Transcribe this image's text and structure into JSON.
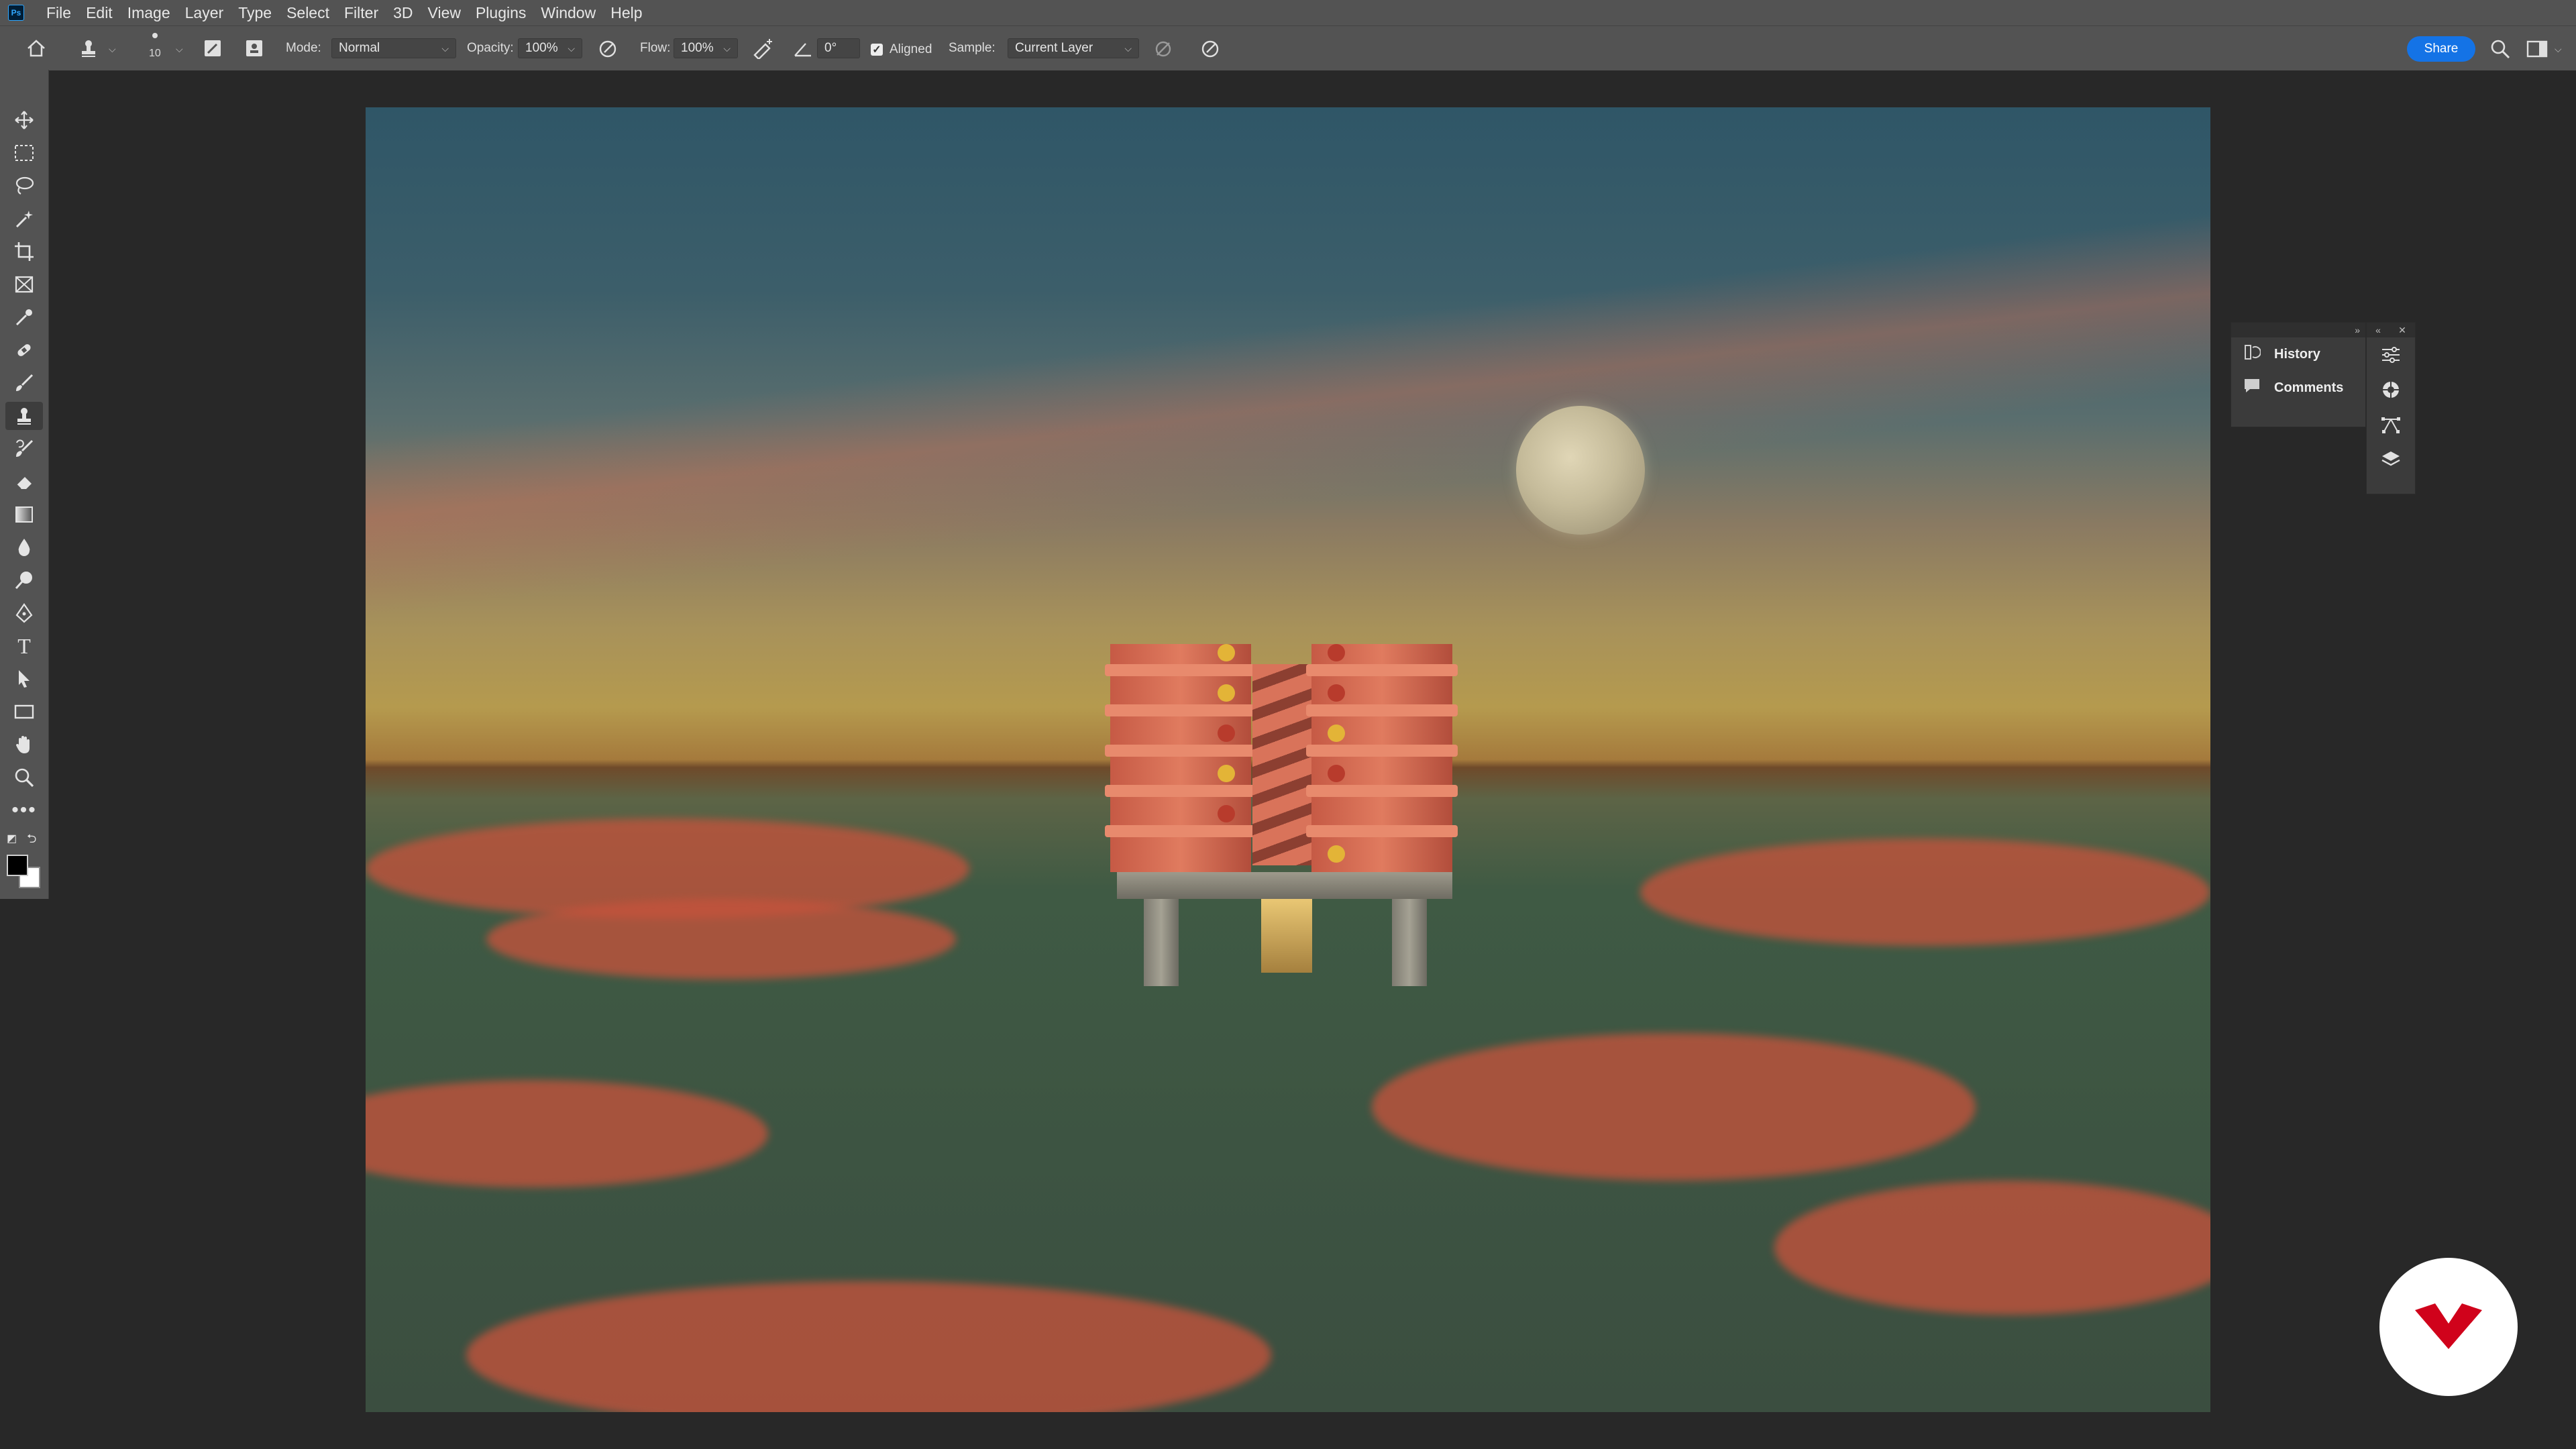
{
  "menubar": {
    "app_icon": "Ps",
    "items": [
      "File",
      "Edit",
      "Image",
      "Layer",
      "Type",
      "Select",
      "Filter",
      "3D",
      "View",
      "Plugins",
      "Window",
      "Help"
    ]
  },
  "options": {
    "home_icon": "home-icon",
    "tool_icon": "clone-stamp-icon",
    "brush_size": "10",
    "mode_label": "Mode:",
    "mode_value": "Normal",
    "opacity_label": "Opacity:",
    "opacity_value": "100%",
    "flow_label": "Flow:",
    "flow_value": "100%",
    "angle_value": "0°",
    "aligned_label": "Aligned",
    "aligned_checked": true,
    "sample_label": "Sample:",
    "sample_value": "Current Layer",
    "share_label": "Share"
  },
  "toolbar": {
    "tools": [
      "move-tool-icon",
      "rectangular-marquee-icon",
      "lasso-icon",
      "magic-wand-icon",
      "crop-icon",
      "frame-icon",
      "eyedropper-icon",
      "healing-brush-icon",
      "brush-icon",
      "clone-stamp-icon",
      "history-brush-icon",
      "eraser-icon",
      "gradient-icon",
      "blur-icon",
      "dodge-icon",
      "pen-icon",
      "type-icon",
      "path-selection-icon",
      "rectangle-icon",
      "hand-icon",
      "zoom-icon",
      "more-tools-icon"
    ],
    "active_tool": "clone-stamp-icon",
    "foreground_color": "#000000",
    "background_color": "#ffffff"
  },
  "panel": {
    "items": [
      {
        "icon": "history-icon",
        "label": "History"
      },
      {
        "icon": "comments-icon",
        "label": "Comments"
      }
    ],
    "side_icons": [
      "adjustments-icon",
      "color-wheel-icon",
      "paths-icon",
      "layers-icon"
    ]
  },
  "watermark": {
    "color": "#d0021b"
  }
}
